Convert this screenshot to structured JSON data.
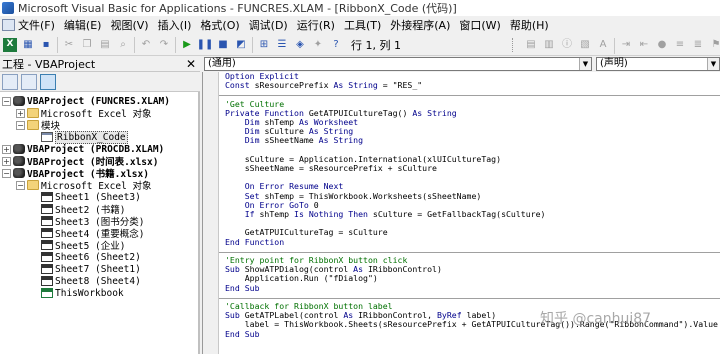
{
  "window": {
    "title": "Microsoft Visual Basic for Applications - FUNCRES.XLAM - [RibbonX_Code (代码)]"
  },
  "menu": [
    {
      "label": "文件(F)"
    },
    {
      "label": "编辑(E)"
    },
    {
      "label": "视图(V)"
    },
    {
      "label": "插入(I)"
    },
    {
      "label": "格式(O)"
    },
    {
      "label": "调试(D)"
    },
    {
      "label": "运行(R)"
    },
    {
      "label": "工具(T)"
    },
    {
      "label": "外接程序(A)"
    },
    {
      "label": "窗口(W)"
    },
    {
      "label": "帮助(H)"
    }
  ],
  "toolbar": {
    "position": "行 1, 列 1"
  },
  "project_pane": {
    "title": "工程 - VBAProject",
    "nodes": [
      {
        "label": "VBAProject (FUNCRES.XLAM)"
      },
      {
        "label": "Microsoft Excel 对象"
      },
      {
        "label": "模块"
      },
      {
        "label": "RibbonX_Code"
      },
      {
        "label": "VBAProject (PROCDB.XLAM)"
      },
      {
        "label": "VBAProject (时间表.xlsx)"
      },
      {
        "label": "VBAProject (书籍.xlsx)"
      },
      {
        "label": "Microsoft Excel 对象"
      },
      {
        "label": "Sheet1 (Sheet3)"
      },
      {
        "label": "Sheet2 (书籍)"
      },
      {
        "label": "Sheet3 (图书分类)"
      },
      {
        "label": "Sheet4 (重要概念)"
      },
      {
        "label": "Sheet5 (企业)"
      },
      {
        "label": "Sheet6 (Sheet2)"
      },
      {
        "label": "Sheet7 (Sheet1)"
      },
      {
        "label": "Sheet8 (Sheet4)"
      },
      {
        "label": "ThisWorkbook"
      }
    ]
  },
  "combos": {
    "object": "(通用)",
    "procedure": "(声明)"
  },
  "code_blocks": [
    [
      "Option Explicit",
      "Const sResourcePrefix As String = \"RES_\""
    ],
    [
      "'Get Culture",
      "Private Function GetATPUICultureTag() As String",
      "    Dim shTemp As Worksheet",
      "    Dim sCulture As String",
      "    Dim sSheetName As String",
      "",
      "    sCulture = Application.International(xlUICultureTag)",
      "    sSheetName = sResourcePrefix + sCulture",
      "",
      "    On Error Resume Next",
      "    Set shTemp = ThisWorkbook.Worksheets(sSheetName)",
      "    On Error GoTo 0",
      "    If shTemp Is Nothing Then sCulture = GetFallbackTag(sCulture)",
      "",
      "    GetATPUICultureTag = sCulture",
      "End Function"
    ],
    [
      "'Entry point for RibbonX button click",
      "Sub ShowATPDialog(control As IRibbonControl)",
      "    Application.Run (\"fDialog\")",
      "End Sub"
    ],
    [
      "'Callback for RibbonX button label",
      "Sub GetATPLabel(control As IRibbonControl, ByRef label)",
      "    label = ThisWorkbook.Sheets(sResourcePrefix + GetATPUICultureTag()).Range(\"RibbonCommand\").Value",
      "End Sub"
    ]
  ],
  "watermark": "知乎 @canhui87"
}
